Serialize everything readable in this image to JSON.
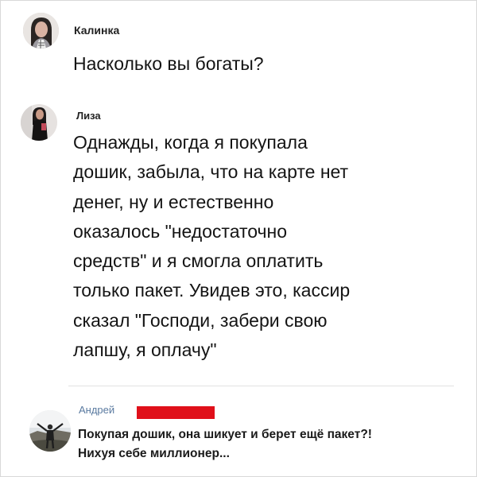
{
  "posts": [
    {
      "author": "Калинка",
      "avatar_icon": "profile-photo-woman",
      "text": "Насколько вы богаты?"
    },
    {
      "author": "Лиза",
      "avatar_icon": "profile-photo-woman-standing",
      "lines": [
        "Однажды, когда я покупала",
        "дошик, забыла, что на карте нет",
        "денег, ну и естественно",
        "оказалось \"недостаточно",
        "средств\" и я смогла оплатить",
        "только пакет. Увидев это, кассир",
        "сказал \"Господи, забери свою",
        "лапшу, я оплачу\""
      ]
    },
    {
      "author": "Андрей",
      "avatar_icon": "profile-photo-man-outdoors",
      "redaction_color": "#e0101a",
      "lines": [
        "Покупая дошик, она шикует и берет ещё пакет?!",
        "Нихуя себе миллионер..."
      ]
    }
  ]
}
